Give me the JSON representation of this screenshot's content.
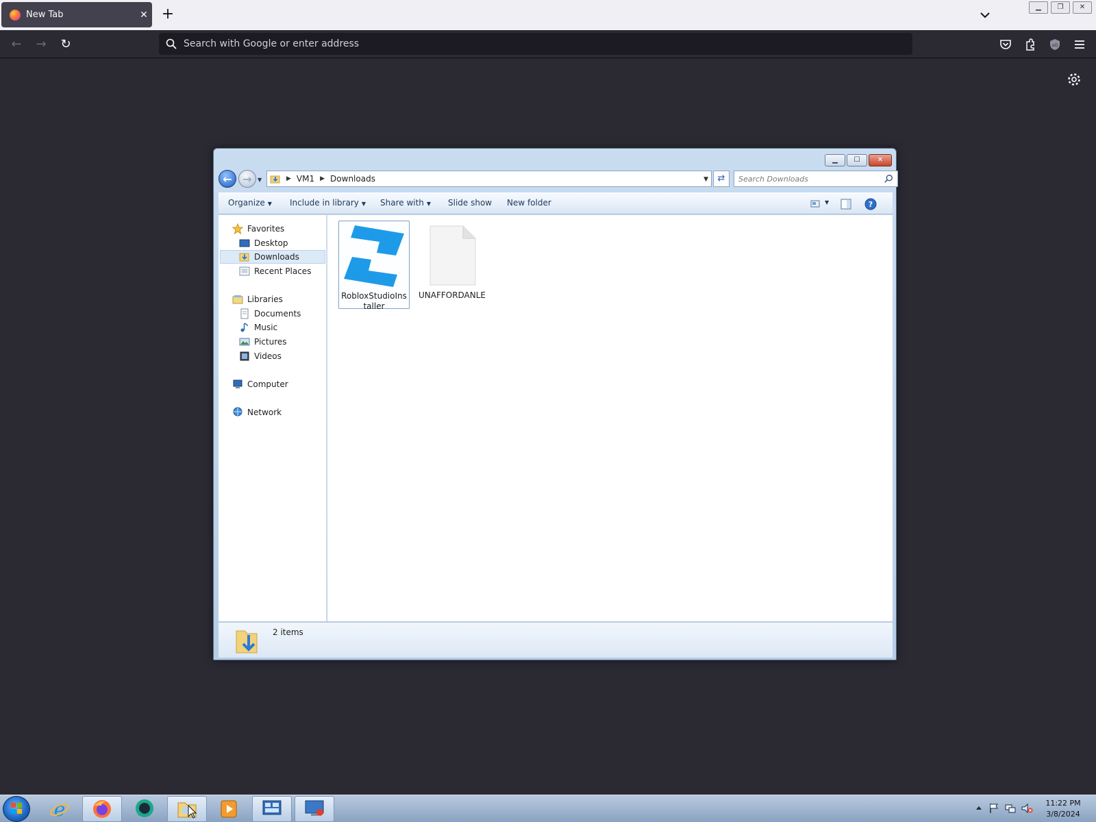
{
  "browser": {
    "tab_title": "New Tab",
    "tab_close": "✕",
    "new_tab": "+",
    "url_placeholder": "Search with Google or enter address"
  },
  "explorer": {
    "breadcrumb": [
      "VM1",
      "Downloads"
    ],
    "search_placeholder": "Search Downloads",
    "commands": {
      "organize": "Organize",
      "include_in_library": "Include in library",
      "share_with": "Share with",
      "slide_show": "Slide show",
      "new_folder": "New folder"
    },
    "nav": {
      "favorites": "Favorites",
      "desktop": "Desktop",
      "downloads": "Downloads",
      "recent_places": "Recent Places",
      "libraries": "Libraries",
      "documents": "Documents",
      "music": "Music",
      "pictures": "Pictures",
      "videos": "Videos",
      "computer": "Computer",
      "network": "Network"
    },
    "files": [
      {
        "name": "RobloxStudioInstaller",
        "icon": "roblox-studio-icon",
        "selected": true
      },
      {
        "name": "UNAFFORDANLE",
        "icon": "blank-file-icon",
        "selected": false
      }
    ],
    "status": "2 items"
  },
  "taskbar": {
    "time": "11:22 PM",
    "date": "3/8/2024"
  },
  "colors": {
    "browser_bg": "#2b2a33",
    "tabstrip": "#f0f0f4",
    "explorer_frame": "#c9dcf0",
    "roblox_blue": "#1e9be8"
  }
}
